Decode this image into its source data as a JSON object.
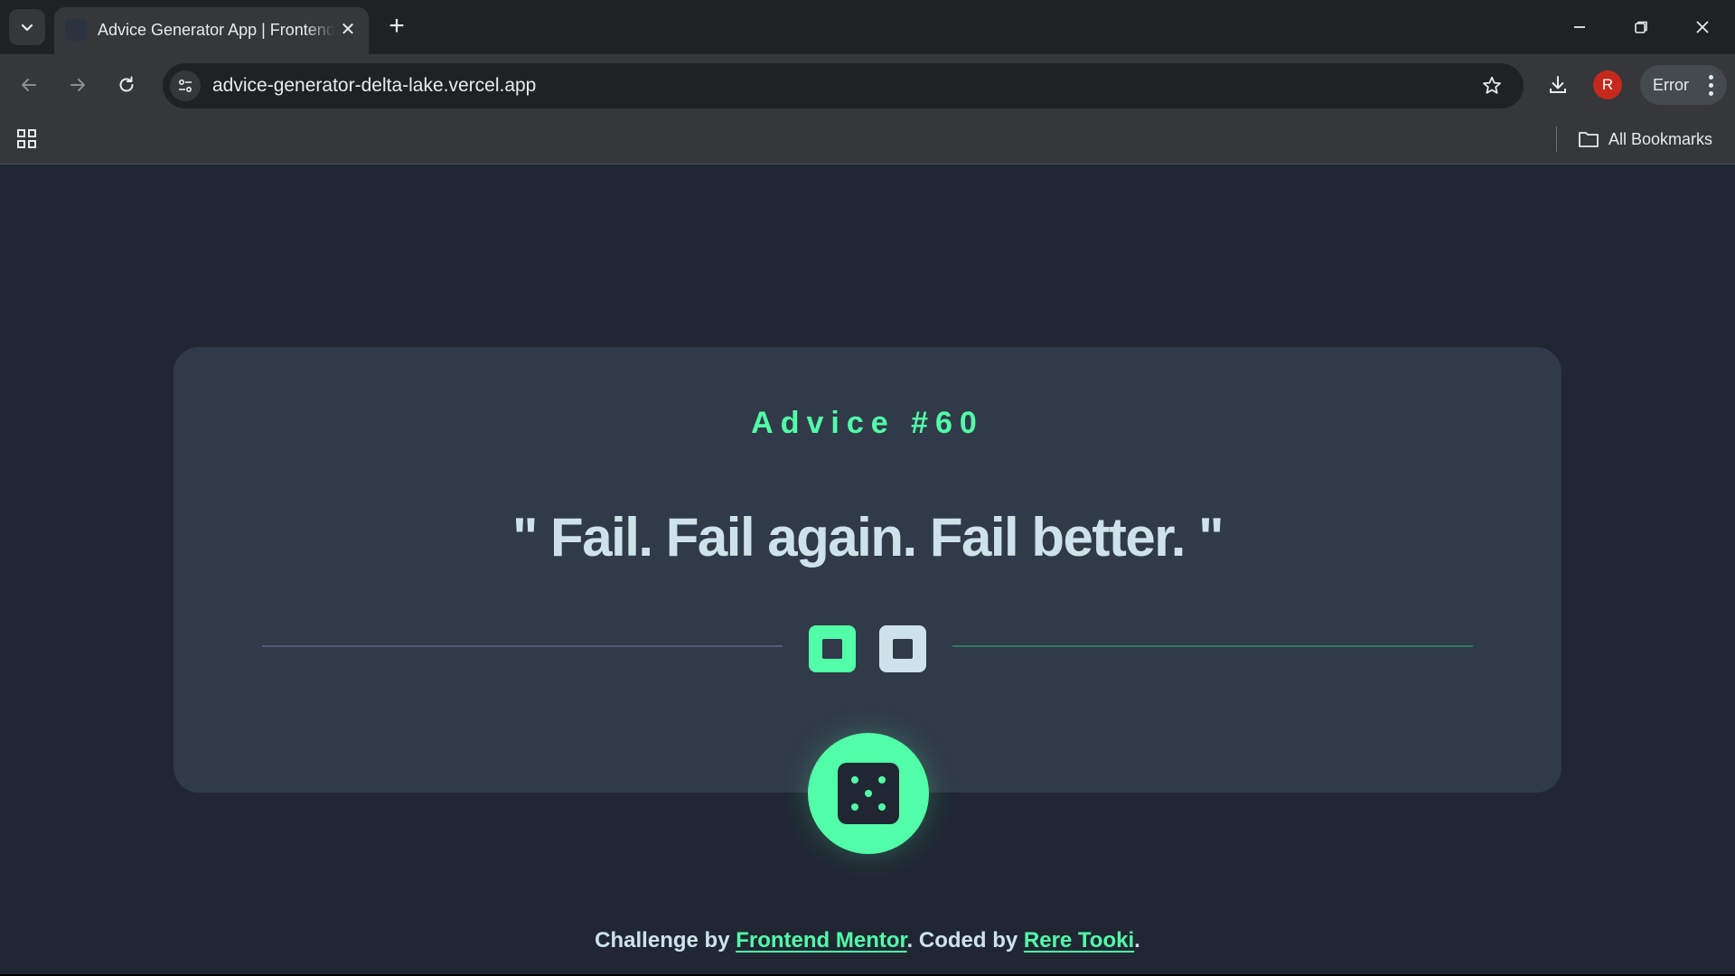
{
  "browser": {
    "tab": {
      "title": "Advice Generator App | Frontend Mentor",
      "favicon": "dice-favicon"
    },
    "new_tab_label": "+",
    "close_tab_label": "✕",
    "address": {
      "url": "advice-generator-delta-lake.vercel.app"
    },
    "profile": {
      "initial": "R",
      "color": "#c4291c"
    },
    "status_pill": {
      "label": "Error"
    },
    "bookmarks": {
      "all_label": "All Bookmarks"
    },
    "icons": [
      "tab-search-icon",
      "back-icon",
      "forward-icon",
      "reload-icon",
      "site-info-icon",
      "star-icon",
      "download-icon",
      "kebab-menu-icon",
      "apps-icon",
      "folder-icon",
      "minimize-icon",
      "restore-icon",
      "close-window-icon"
    ]
  },
  "card": {
    "advice_label": "Advice #60",
    "quote": "\" Fail. Fail again. Fail better. \""
  },
  "footer": {
    "prefix": "Challenge by ",
    "mentor_link": "Frontend Mentor",
    "middle": ". Coded by ",
    "author_link": "Rere Tooki",
    "suffix": "."
  },
  "colors": {
    "accent": "#52ffa8",
    "text": "#cee3e9",
    "card": "#313a48",
    "background": "#202733"
  }
}
